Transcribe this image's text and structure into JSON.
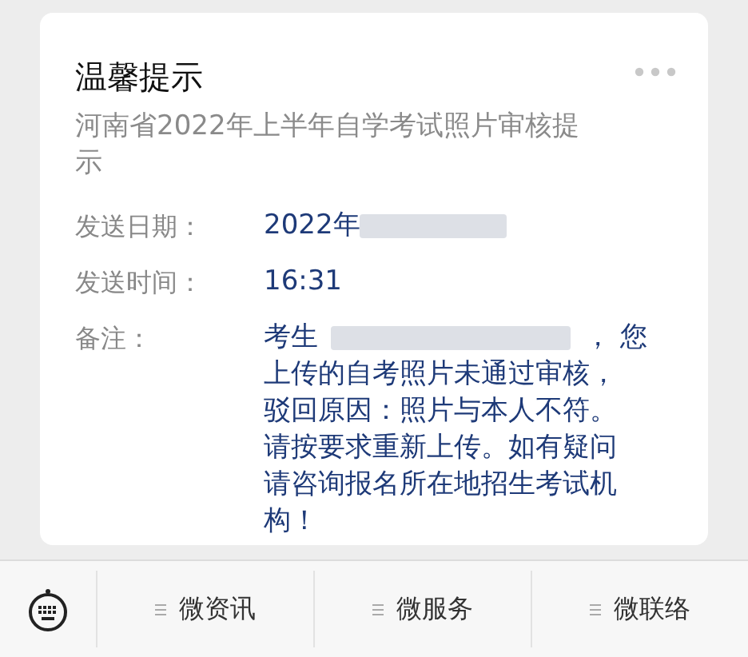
{
  "card": {
    "title": "温馨提示",
    "subtitle": "河南省2022年上半年自学考试照片审核提示",
    "fields": [
      {
        "label": "发送日期：",
        "value": "2022年",
        "redacted": true
      },
      {
        "label": "发送时间：",
        "value": "16:31",
        "redacted": false
      }
    ],
    "remark": {
      "label": "备注：",
      "before": "考生",
      "redacted": true,
      "after": "，  您",
      "lines": [
        "上传的自考照片未通过审核，",
        "驳回原因：照片与本人不符。",
        "请按要求重新上传。如有疑问",
        "请咨询报名所在地招生考试机",
        "构！"
      ]
    }
  },
  "menu_bar": {
    "items": [
      {
        "label": "微资讯"
      },
      {
        "label": "微服务"
      },
      {
        "label": "微联络"
      }
    ]
  }
}
